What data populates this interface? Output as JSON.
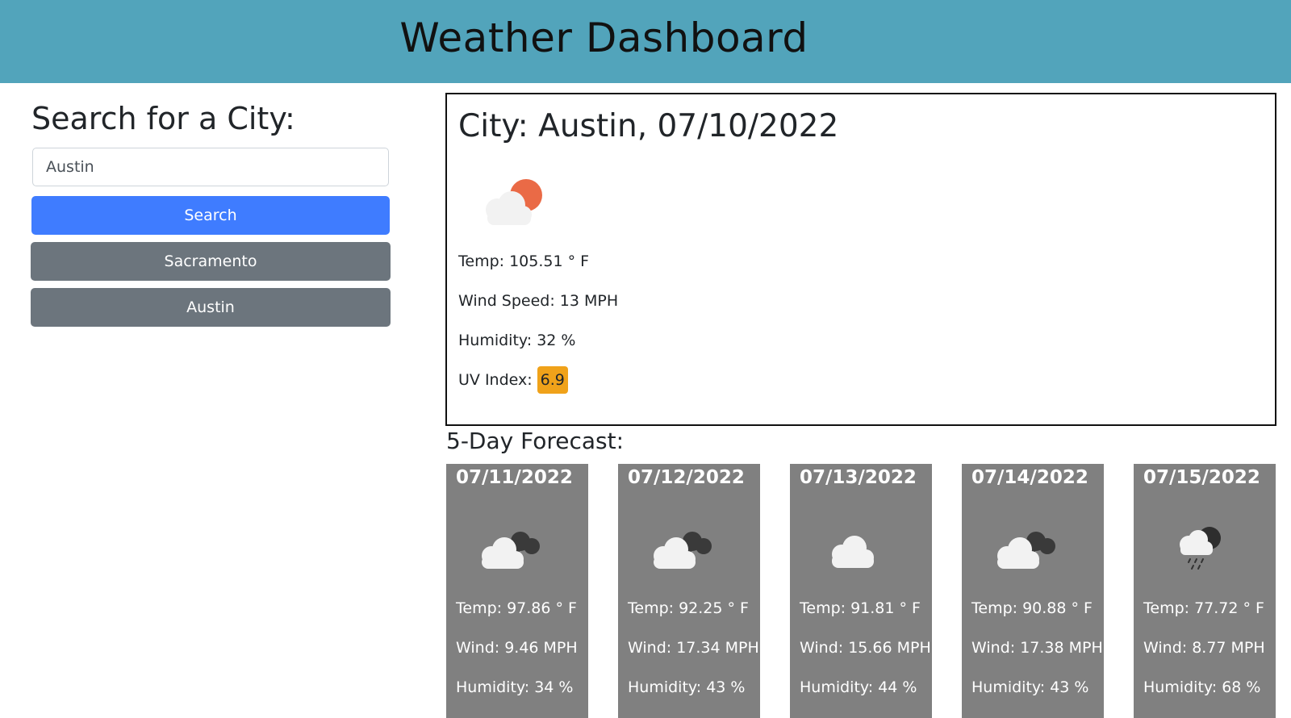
{
  "header": {
    "title": "Weather Dashboard"
  },
  "search": {
    "heading": "Search for a City:",
    "input_value": "Austin",
    "button_label": "Search",
    "history": [
      "Sacramento",
      "Austin"
    ]
  },
  "current": {
    "title": "City: Austin, 07/10/2022",
    "icon": "partly-cloudy-sun-icon",
    "temp": "Temp: 105.51 ° F",
    "wind": "Wind Speed: 13 MPH",
    "humidity": "Humidity: 32 %",
    "uv_label": "UV Index:",
    "uv_value": "6.9",
    "uv_color": "#f0a21a"
  },
  "forecast": {
    "title": "5-Day Forecast:",
    "days": [
      {
        "date": "07/11/2022",
        "icon": "broken-clouds-icon",
        "temp": "Temp: 97.86 ° F",
        "wind": "Wind: 9.46 MPH",
        "humidity": "Humidity: 34 %"
      },
      {
        "date": "07/12/2022",
        "icon": "broken-clouds-icon",
        "temp": "Temp: 92.25 ° F",
        "wind": "Wind: 17.34 MPH",
        "humidity": "Humidity: 43 %"
      },
      {
        "date": "07/13/2022",
        "icon": "cloud-icon",
        "temp": "Temp: 91.81 ° F",
        "wind": "Wind: 15.66 MPH",
        "humidity": "Humidity: 44 %"
      },
      {
        "date": "07/14/2022",
        "icon": "broken-clouds-icon",
        "temp": "Temp: 90.88 ° F",
        "wind": "Wind: 17.38 MPH",
        "humidity": "Humidity: 43 %"
      },
      {
        "date": "07/15/2022",
        "icon": "rain-cloud-icon",
        "temp": "Temp: 77.72 ° F",
        "wind": "Wind: 8.77 MPH",
        "humidity": "Humidity: 68 %"
      }
    ]
  },
  "colors": {
    "header_bg": "#52a4bb",
    "primary": "#3f7cff",
    "secondary": "#6c757d",
    "card_bg": "#808080"
  }
}
